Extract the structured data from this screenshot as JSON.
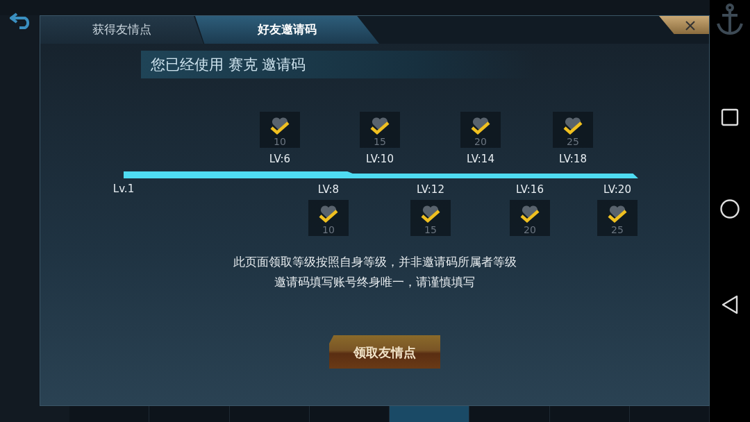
{
  "tabs": [
    {
      "label": "获得友情点",
      "selected": false
    },
    {
      "label": "好友邀请码",
      "selected": true
    }
  ],
  "banner": {
    "text": "您已经使用 赛克 邀请码"
  },
  "progress": {
    "start_label": "Lv.1"
  },
  "milestones": [
    {
      "level_label": "LV:6",
      "amount": "10",
      "claimed": true,
      "kind": "above"
    },
    {
      "level_label": "LV:8",
      "amount": "10",
      "claimed": true,
      "kind": "below"
    },
    {
      "level_label": "LV:10",
      "amount": "15",
      "claimed": true,
      "kind": "above"
    },
    {
      "level_label": "LV:12",
      "amount": "15",
      "claimed": true,
      "kind": "below"
    },
    {
      "level_label": "LV:14",
      "amount": "20",
      "claimed": true,
      "kind": "above"
    },
    {
      "level_label": "LV:16",
      "amount": "20",
      "claimed": true,
      "kind": "below"
    },
    {
      "level_label": "LV:18",
      "amount": "25",
      "claimed": true,
      "kind": "above"
    },
    {
      "level_label": "LV:20",
      "amount": "25",
      "claimed": true,
      "kind": "below"
    }
  ],
  "notes": [
    "此页面领取等级按照自身等级，并非邀请码所属者等级",
    "邀请码填写账号终身唯一，请谨慎填写"
  ],
  "claim_button": {
    "label": "领取友情点"
  }
}
